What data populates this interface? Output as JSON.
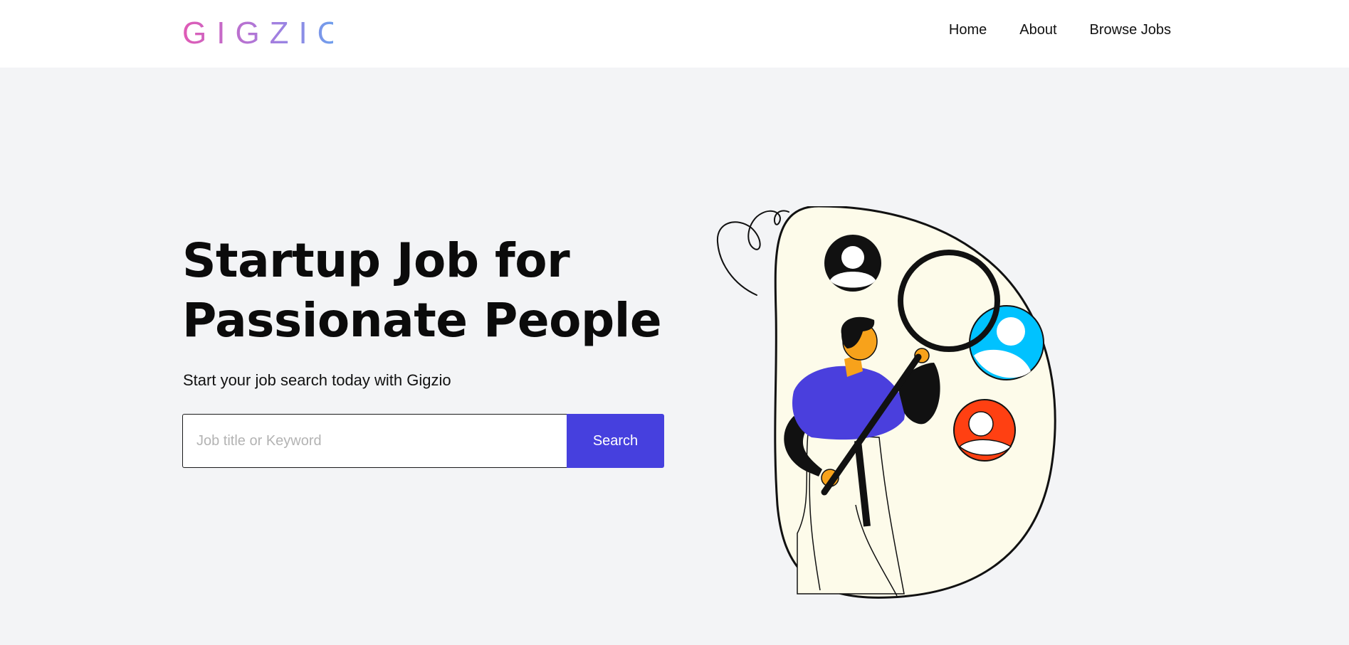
{
  "brand": {
    "logo_text": "GIGZIO",
    "gradient_start": "#e05ab5",
    "gradient_end": "#5fa8f0"
  },
  "nav": {
    "items": [
      {
        "label": "Home"
      },
      {
        "label": "About"
      },
      {
        "label": "Browse Jobs"
      }
    ]
  },
  "hero": {
    "headline_line1": "Startup Job for",
    "headline_line2": "Passionate People",
    "subtitle": "Start your job search today with Gigzio",
    "search": {
      "placeholder": "Job title or Keyword",
      "value": "",
      "button_label": "Search"
    }
  },
  "colors": {
    "accent": "#4640de",
    "hero_background": "#f3f4f6",
    "blob_fill": "#fdfbea",
    "avatar_black": "#111111",
    "avatar_blue": "#00c2ff",
    "avatar_red": "#ff4012",
    "shirt": "#4a3fdd",
    "skin": "#f7a21b"
  },
  "illustration": {
    "icons": [
      "person-with-magnifier",
      "avatar-black-icon",
      "avatar-blue-icon",
      "avatar-red-icon"
    ]
  }
}
